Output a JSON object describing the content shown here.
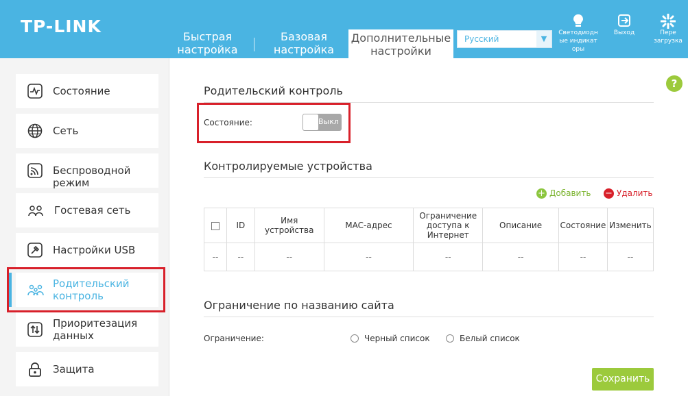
{
  "header": {
    "logo": "TP-LINK",
    "tabs": [
      {
        "line1": "Быстрая",
        "line2": "настройка"
      },
      {
        "line1": "Базовая",
        "line2": "настройка"
      },
      {
        "line1": "Дополнительные",
        "line2": "настройки"
      }
    ],
    "language": "Русский",
    "led_label": "Светодиоды индикаторы",
    "led_line1": "Светодиодн",
    "led_line2": "ые индикат",
    "led_line3": "оры",
    "exit_label": "Выход",
    "reboot_line1": "Пере",
    "reboot_line2": "загрузка",
    "brand_color": "#4ab4e2"
  },
  "sidebar": {
    "items": [
      {
        "label": "Состояние",
        "icon": "activity-icon"
      },
      {
        "label": "Сеть",
        "icon": "globe-icon"
      },
      {
        "label": "Беспроводной режим",
        "icon": "wifi-icon"
      },
      {
        "label": "Гостевая сеть",
        "icon": "guests-icon"
      },
      {
        "label": "Настройки USB",
        "icon": "usb-icon"
      },
      {
        "line1": "Родительский",
        "line2": "контроль",
        "icon": "family-icon",
        "active": true
      },
      {
        "line1": "Приоритезация",
        "line2": "данных",
        "icon": "priority-icon"
      },
      {
        "label": "Защита",
        "icon": "lock-icon"
      }
    ]
  },
  "main": {
    "help": "?",
    "parental_title": "Родительский контроль",
    "status_label": "Состояние:",
    "toggle_text": "Выкл",
    "devices_title": "Контролируемые устройства",
    "add_label": "Добавить",
    "delete_label": "Удалить",
    "table": {
      "headers": [
        "ID",
        "Имя устройства",
        "MAC-адрес",
        "Ограничение доступа к Интернет",
        "Описание",
        "Состояние",
        "Изменить"
      ],
      "row": [
        "--",
        "--",
        "--",
        "--",
        "--",
        "--",
        "--",
        "--"
      ]
    },
    "site_title": "Ограничение по названию сайта",
    "limit_label": "Ограничение:",
    "black_list": "Черный список",
    "white_list": "Белый список",
    "save_label": "Сохранить"
  }
}
